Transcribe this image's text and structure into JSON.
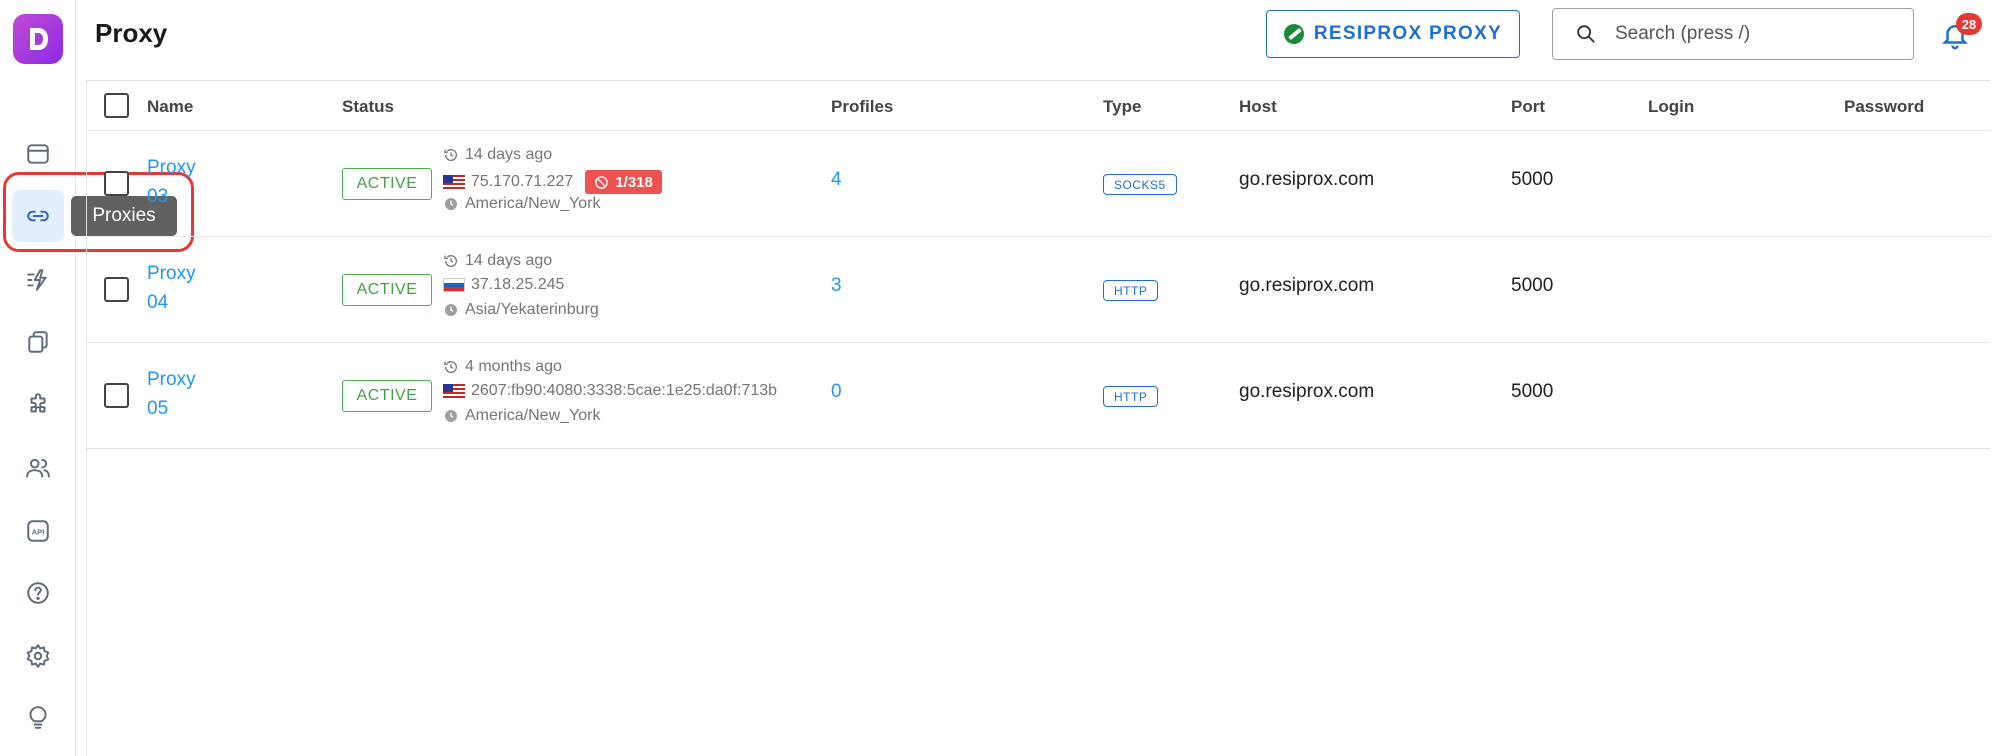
{
  "header": {
    "title": "Proxy",
    "resiprox_button": "RESIPROX PROXY",
    "search_placeholder": "Search (press /)",
    "notifications_count": "28"
  },
  "sidebar": {
    "tooltip": "Proxies",
    "items": [
      {
        "icon": "browser-window-icon"
      },
      {
        "icon": "link-icon",
        "active": true
      },
      {
        "icon": "automation-icon"
      },
      {
        "icon": "copy-pages-icon"
      },
      {
        "icon": "puzzle-icon"
      },
      {
        "icon": "users-icon"
      },
      {
        "icon": "api-icon"
      },
      {
        "icon": "help-icon"
      },
      {
        "icon": "gear-icon"
      },
      {
        "icon": "lightbulb-icon"
      }
    ]
  },
  "table": {
    "columns": [
      "Name",
      "Status",
      "Profiles",
      "Type",
      "Host",
      "Port",
      "Login",
      "Password"
    ],
    "rows": [
      {
        "name": "Proxy 03",
        "status": "ACTIVE",
        "checked_ago": "14 days ago",
        "ip": "75.170.71.227",
        "country": "us",
        "blocked": "1/318",
        "timezone": "America/New_York",
        "profiles": "4",
        "type": "SOCKS5",
        "host": "go.resiprox.com",
        "port": "5000"
      },
      {
        "name": "Proxy 04",
        "status": "ACTIVE",
        "checked_ago": "14 days ago",
        "ip": "37.18.25.245",
        "country": "ru",
        "timezone": "Asia/Yekaterinburg",
        "profiles": "3",
        "type": "HTTP",
        "host": "go.resiprox.com",
        "port": "5000"
      },
      {
        "name": "Proxy 05",
        "status": "ACTIVE",
        "checked_ago": "4 months ago",
        "ip": "2607:fb90:4080:3338:5cae:1e25:da0f:713b",
        "country": "us",
        "timezone": "America/New_York",
        "profiles": "0",
        "type": "HTTP",
        "host": "go.resiprox.com",
        "port": "5000"
      }
    ]
  },
  "colors": {
    "accent": "#1e6fcf",
    "link": "#2196f3",
    "active_green": "#43a047",
    "danger": "#e53935",
    "brand_purple": "#8a2be2"
  }
}
